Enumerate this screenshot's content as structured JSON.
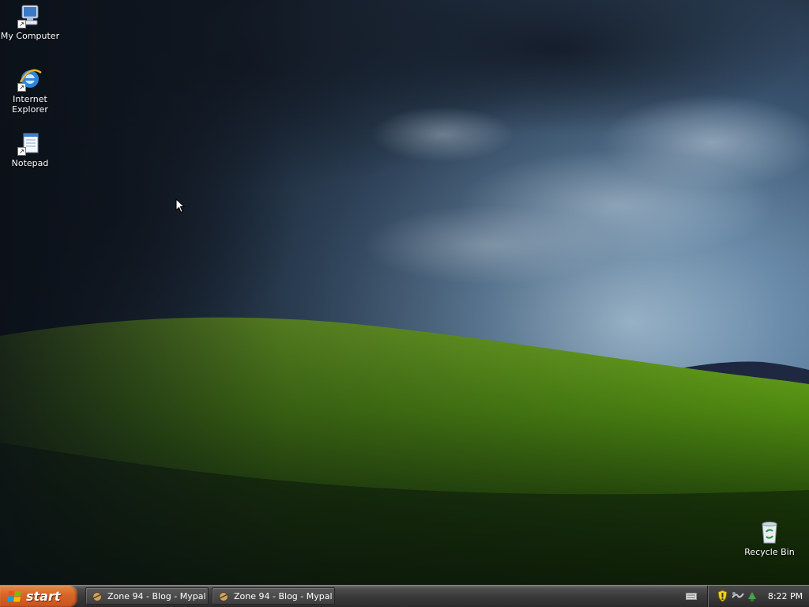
{
  "desktop": {
    "icons": [
      {
        "label": "My Computer",
        "icon": "my-computer-icon"
      },
      {
        "label": "Internet Explorer",
        "icon": "internet-explorer-icon"
      },
      {
        "label": "Notepad",
        "icon": "notepad-icon"
      },
      {
        "label": "Recycle Bin",
        "icon": "recycle-bin-icon"
      }
    ]
  },
  "taskbar": {
    "start_label": "start",
    "tasks": [
      {
        "label": "Zone 94 - Blog - Mypal",
        "icon": "mypal-browser-icon"
      },
      {
        "label": "Zone 94 - Blog - Mypal",
        "icon": "mypal-browser-icon"
      }
    ],
    "tray": {
      "icons": [
        "keyboard-icon",
        "security-shield-icon",
        "network-icon",
        "safely-remove-hardware-icon"
      ],
      "clock": "8:22 PM"
    }
  },
  "colors": {
    "start_button": "#d8672a",
    "taskbar": "#3a3a3a",
    "sky": "#3c5a78",
    "hill": "#4f8a10"
  }
}
